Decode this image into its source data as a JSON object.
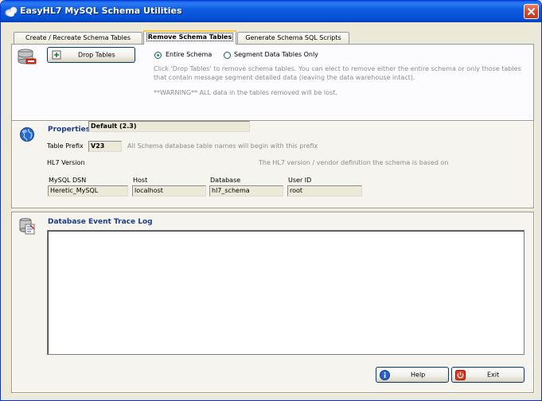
{
  "window": {
    "title": "EasyHL7 MySQL Schema Utilities"
  },
  "tabs": [
    {
      "label": "Create / Recreate Schema Tables"
    },
    {
      "label": "Remove Schema Tables"
    },
    {
      "label": "Generate Schema SQL Scripts"
    }
  ],
  "remove": {
    "drop_label": "Drop Tables",
    "radio_entire": "Entire Schema",
    "radio_segment": "Segment Data Tables Only",
    "desc_line1": "Click 'Drop Tables' to remove schema tables.  You can elect to remove either the entire schema or only those tables",
    "desc_line2": "that contain message segment detailed data (leaving the data warehouse intact).",
    "warning": "**WARNING** ALL data in the tables removed will be lost."
  },
  "properties": {
    "heading": "Properties for: ADT Warehouse",
    "prefix_label": "Table Prefix",
    "prefix_value": "V23",
    "prefix_hint": "All Schema database table names will begin with this prefix",
    "version_label": "HL7 Version",
    "version_value": "Default (2.3)",
    "version_hint": "The HL7 version / vendor definition the schema is based on",
    "dsn_label": "MySQL DSN",
    "dsn_value": "Heretic_MySQL",
    "host_label": "Host",
    "host_value": "localhost",
    "db_label": "Database",
    "db_value": "hl7_schema",
    "user_label": "User ID",
    "user_value": "root"
  },
  "trace": {
    "heading": "Database Event Trace Log"
  },
  "footer": {
    "help_label": "Help",
    "exit_label": "Exit"
  }
}
